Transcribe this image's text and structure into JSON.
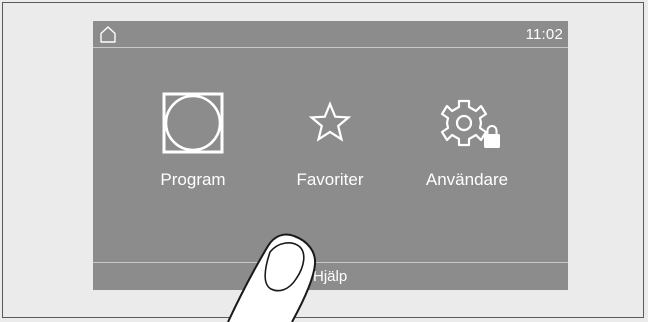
{
  "status_bar": {
    "home_icon": "home-icon",
    "time": "11:02"
  },
  "menu": {
    "items": [
      {
        "label": "Program",
        "icon": "program-icon"
      },
      {
        "label": "Favoriter",
        "icon": "star-icon"
      },
      {
        "label": "Användare",
        "icon": "gear-lock-icon"
      }
    ]
  },
  "bottom_bar": {
    "help_label": "Hjälp"
  },
  "colors": {
    "screen_bg": "#8c8c8c",
    "page_bg": "#ebebeb",
    "text": "#ffffff"
  }
}
